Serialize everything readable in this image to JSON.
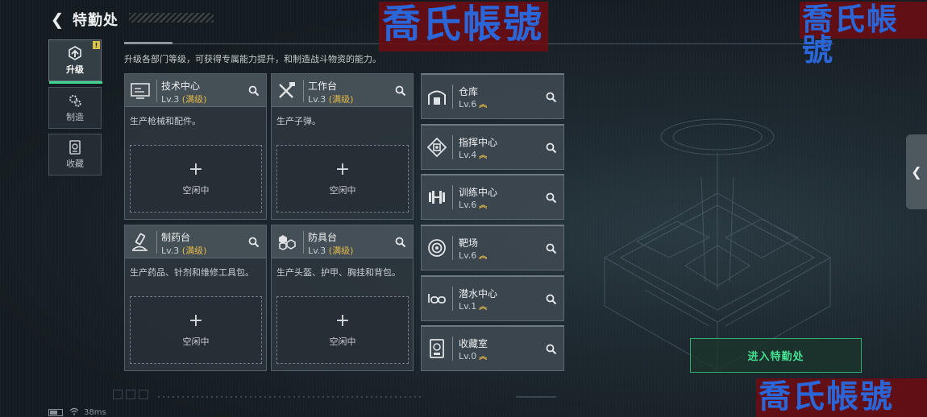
{
  "header": {
    "title": "特勤处"
  },
  "watermark": {
    "text": "喬氏帳號"
  },
  "sidebar": {
    "items": [
      {
        "label": "升级",
        "icon": "upgrade-icon",
        "active": true,
        "badge": "!"
      },
      {
        "label": "制造",
        "icon": "gears-icon",
        "active": false
      },
      {
        "label": "收藏",
        "icon": "collection-icon",
        "active": false
      }
    ]
  },
  "main": {
    "subtitle": "升级各部门等级，可获得专属能力提升，和制造战斗物资的能力。",
    "workshops": [
      {
        "name": "技术中心",
        "level": "Lv.3",
        "max": "(满级)",
        "desc": "生产枪械和配件。",
        "slot_action": "+",
        "slot_status": "空闲中",
        "icon": "tech-center-icon"
      },
      {
        "name": "工作台",
        "level": "Lv.3",
        "max": "(满级)",
        "desc": "生产子弹。",
        "slot_action": "+",
        "slot_status": "空闲中",
        "icon": "workbench-icon"
      },
      {
        "name": "制药台",
        "level": "Lv.3",
        "max": "(满级)",
        "desc": "生产药品、针剂和维修工具包。",
        "slot_action": "+",
        "slot_status": "空闲中",
        "icon": "pharmacy-icon"
      },
      {
        "name": "防具台",
        "level": "Lv.3",
        "max": "(满级)",
        "desc": "生产头盔、护甲、胸挂和背包。",
        "slot_action": "+",
        "slot_status": "空闲中",
        "icon": "armor-bench-icon"
      }
    ],
    "facilities": [
      {
        "name": "仓库",
        "level": "Lv.6",
        "icon": "warehouse-icon"
      },
      {
        "name": "指挥中心",
        "level": "Lv.4",
        "icon": "command-center-icon"
      },
      {
        "name": "训练中心",
        "level": "Lv.6",
        "icon": "dumbbell-icon"
      },
      {
        "name": "靶场",
        "level": "Lv.6",
        "icon": "target-icon"
      },
      {
        "name": "潜水中心",
        "level": "Lv.1",
        "icon": "diving-mask-icon"
      },
      {
        "name": "收藏室",
        "level": "Lv.0",
        "icon": "collection-room-icon"
      }
    ],
    "enter_button": "进入特勤处"
  },
  "status_bar": {
    "ping": "38ms"
  },
  "colors": {
    "accent": "#3fd690",
    "max_level": "#e2b94a",
    "upgrade_chevron": "#e2b94a"
  }
}
